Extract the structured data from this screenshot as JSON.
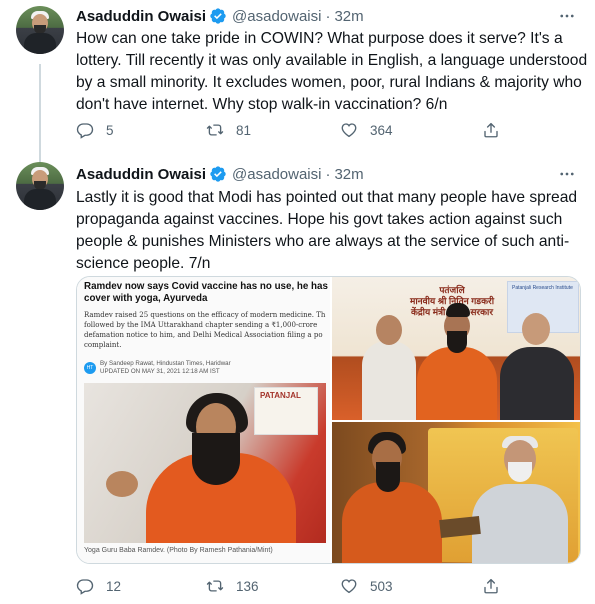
{
  "tweets": [
    {
      "name": "Asaduddin Owaisi",
      "handle": "@asadowaisi",
      "dot": "·",
      "time": "32m",
      "text_lines": [
        "How can one take pride in COWIN? What purpose does it serve? It's a",
        "lottery. Till recently it was only available in English, a language understood",
        "by a small minority. It excludes women, poor, rural Indians & majority who",
        "don't have internet. Why stop walk-in vaccination? 6/n"
      ],
      "replies": "5",
      "retweets": "81",
      "likes": "364"
    },
    {
      "name": "Asaduddin Owaisi",
      "handle": "@asadowaisi",
      "dot": "·",
      "time": "32m",
      "text_lines": [
        "Lastly it is good that Modi has pointed out that many people have spread",
        "propaganda against vaccines. Hope his govt takes action against such",
        "people & punishes Ministers who are always at the service of such anti-",
        "science people. 7/n"
      ],
      "replies": "12",
      "retweets": "136",
      "likes": "503"
    }
  ],
  "media": {
    "article": {
      "headline_lines": [
        "Ramdev now says Covid vaccine has no use, he has du",
        "cover with yoga, Ayurveda"
      ],
      "body_lines": [
        "Ramdev raised 25 questions on the efficacy of modern medicine. Th",
        "followed by the IMA Uttarakhand chapter sending a ₹1,000-crore",
        "defamation notice to him, and Delhi Medical Association filing a po",
        "complaint."
      ],
      "byline_badge": "HT",
      "byline": "By Sandeep Rawat, Hindustan Times, Haridwar",
      "updated": "UPDATED ON MAY 31, 2021 12:18 AM IST",
      "sign_text": "PATANJAL",
      "caption": "Yoga Guru Baba Ramdev. (Photo By Ramesh Pathania/Mint)"
    },
    "event_photo": {
      "banner_lines": [
        "पतंजलि",
        "मानवीय श्री नितिन गडकरी",
        "केंद्रीय मंत्री, भारत सरकार"
      ],
      "panel_title": "Patanjali Research Institute"
    }
  },
  "icons": {
    "more": "more-icon",
    "reply": "reply-icon",
    "retweet": "retweet-icon",
    "like": "like-icon",
    "share": "share-icon",
    "verified": "verified-badge-icon"
  },
  "colors": {
    "text": "#0f1419",
    "secondary": "#536471",
    "verified": "#1d9bf0",
    "divider": "#cfd9de"
  }
}
